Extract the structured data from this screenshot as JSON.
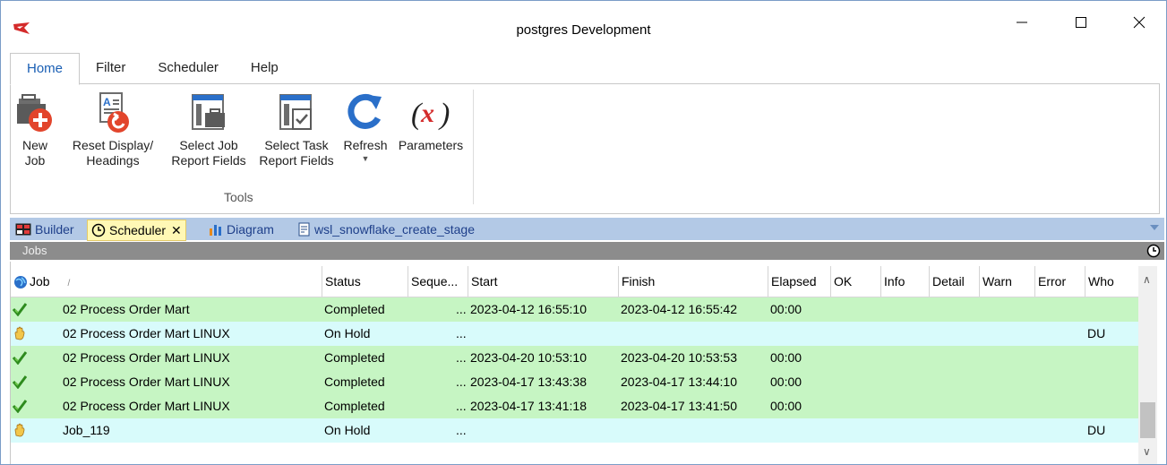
{
  "window": {
    "title": "postgres  Development",
    "minimize_glyph": "—",
    "maximize_glyph": "☐",
    "close_glyph": "✕"
  },
  "ribbon_tabs": [
    "Home",
    "Filter",
    "Scheduler",
    "Help"
  ],
  "ribbon": {
    "buttons": [
      {
        "line1": "New",
        "line2": "Job",
        "icon": "new-job-icon"
      },
      {
        "line1": "Reset Display/",
        "line2": "Headings",
        "icon": "reset-display-icon"
      },
      {
        "line1": "Select Job",
        "line2": "Report Fields",
        "icon": "select-job-fields-icon"
      },
      {
        "line1": "Select Task",
        "line2": "Report Fields",
        "icon": "select-task-fields-icon"
      },
      {
        "line1": "Refresh",
        "line2": "",
        "icon": "refresh-icon"
      },
      {
        "line1": "Parameters",
        "line2": "",
        "icon": "parameters-icon"
      }
    ],
    "group_label": "Tools"
  },
  "doc_tabs": [
    {
      "label": "Builder",
      "icon": "builder-icon"
    },
    {
      "label": "Scheduler",
      "icon": "clock-icon",
      "close": "✕"
    },
    {
      "label": "Diagram",
      "icon": "diagram-icon"
    },
    {
      "label": "wsl_snowflake_create_stage",
      "icon": "script-icon"
    }
  ],
  "panel": {
    "title": "Jobs"
  },
  "grid": {
    "columns": [
      "Job",
      "Status",
      "Seque...",
      "Start",
      "Finish",
      "Elapsed",
      "OK",
      "Info",
      "Detail",
      "Warn",
      "Error",
      "Who"
    ],
    "sort_glyph": "/",
    "rows": [
      {
        "state": "completed",
        "job": "02 Process Order Mart",
        "status": "Completed",
        "seq": "...",
        "start": "2023-04-12 16:55:10",
        "finish": "2023-04-12 16:55:42",
        "elapsed": "00:00",
        "who": ""
      },
      {
        "state": "hold",
        "job": "02 Process Order Mart LINUX",
        "status": "On Hold",
        "seq": "...",
        "start": "",
        "finish": "",
        "elapsed": "",
        "who": "DU"
      },
      {
        "state": "completed",
        "job": "02 Process Order Mart LINUX",
        "status": "Completed",
        "seq": "...",
        "start": "2023-04-20 10:53:10",
        "finish": "2023-04-20 10:53:53",
        "elapsed": "00:00",
        "who": ""
      },
      {
        "state": "completed",
        "job": "02 Process Order Mart LINUX",
        "status": "Completed",
        "seq": "...",
        "start": "2023-04-17 13:43:38",
        "finish": "2023-04-17 13:44:10",
        "elapsed": "00:00",
        "who": ""
      },
      {
        "state": "completed",
        "job": "02 Process Order Mart LINUX",
        "status": "Completed",
        "seq": "...",
        "start": "2023-04-17 13:41:18",
        "finish": "2023-04-17 13:41:50",
        "elapsed": "00:00",
        "who": ""
      },
      {
        "state": "hold",
        "job": "Job_119",
        "status": "On Hold",
        "seq": "...",
        "start": "",
        "finish": "",
        "elapsed": "",
        "who": "DU"
      }
    ]
  },
  "colors": {
    "completed_row": "#c6f5c3",
    "hold_row": "#d8fbfb",
    "accent": "#1a5fb4"
  }
}
